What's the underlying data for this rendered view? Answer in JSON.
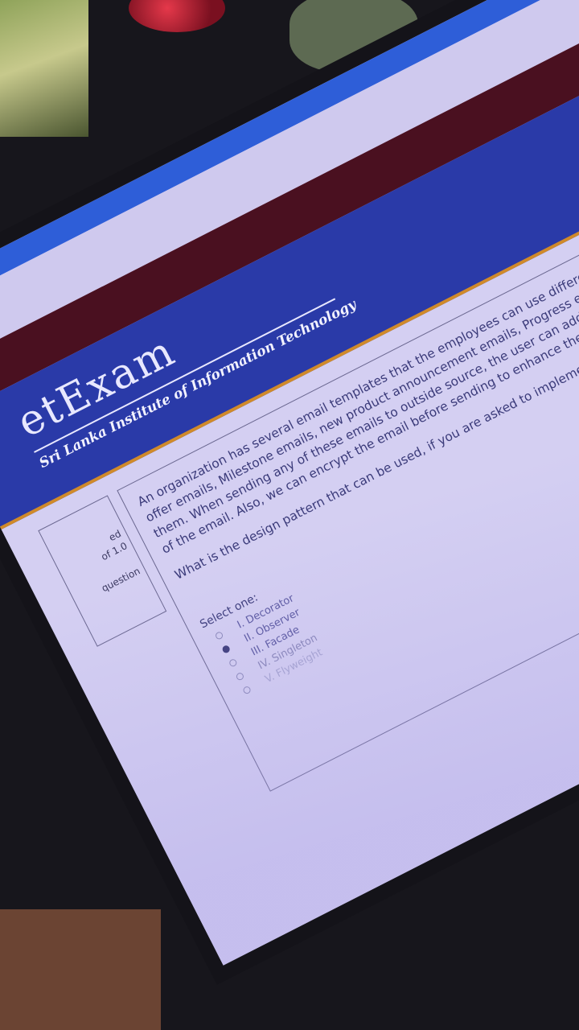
{
  "header": {
    "logo_text": "etExam",
    "institute": "Sri Lanka Institute of Information Technology"
  },
  "info": {
    "lines": [
      "ed",
      "of 1.0",
      "question"
    ]
  },
  "question": {
    "text_lines": [
      "An organization has several email templates that the employees can use different purpose",
      "offer emails, Milestone emails, new product announcement emails, Progress emails and n",
      "them. When sending any of these emails to outside source, the user can add a disclaim",
      "of the email. Also, we can encrypt the email before sending to enhance the security of"
    ],
    "ask": "What is the design pattern that can be used, if you are asked to implement this ema",
    "select_label": "Select one:",
    "options": [
      {
        "label": "I. Decorator",
        "checked": false
      },
      {
        "label": "II. Observer",
        "checked": true
      },
      {
        "label": "III. Facade",
        "checked": false
      },
      {
        "label": "IV. Singleton",
        "checked": false
      },
      {
        "label": "V. Flyweight",
        "checked": false
      }
    ]
  }
}
